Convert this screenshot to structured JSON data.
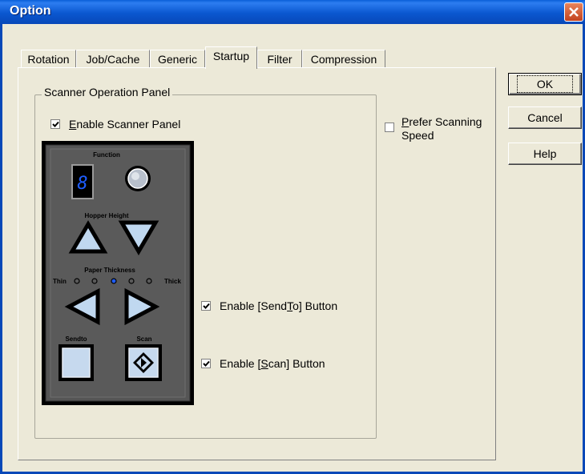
{
  "window": {
    "title": "Option",
    "close_icon": "close-x-icon",
    "accent_color": "#0a57d0"
  },
  "tabs": [
    {
      "label": "Rotation",
      "active": false
    },
    {
      "label": "Job/Cache",
      "active": false
    },
    {
      "label": "Generic",
      "active": false
    },
    {
      "label": "Startup",
      "active": true
    },
    {
      "label": "Filter",
      "active": false
    },
    {
      "label": "Compression",
      "active": false
    }
  ],
  "group": {
    "legend": "Scanner Operation Panel"
  },
  "checkboxes": {
    "enable_panel": {
      "pre": "",
      "u": "E",
      "post": "nable Scanner Panel",
      "checked": true
    },
    "prefer_speed": {
      "pre": "",
      "u": "P",
      "post": "refer Scanning",
      "line2": "Speed",
      "checked": false
    },
    "sendto": {
      "pre": "Enable [Send",
      "u": "T",
      "post": "o] Button",
      "checked": true
    },
    "scan": {
      "pre": "Enable [",
      "u": "S",
      "post": "can] Button",
      "checked": true
    }
  },
  "panel": {
    "function_label": "Function",
    "display_digit": "8",
    "hopper_label": "Hopper Height",
    "thickness_label": "Paper Thickness",
    "thin_label": "Thin",
    "thick_label": "Thick",
    "thickness_selected_index": 2,
    "sendto_label": "Sendto",
    "scan_label": "Scan"
  },
  "buttons": {
    "ok": "OK",
    "cancel": "Cancel",
    "help": "Help"
  }
}
